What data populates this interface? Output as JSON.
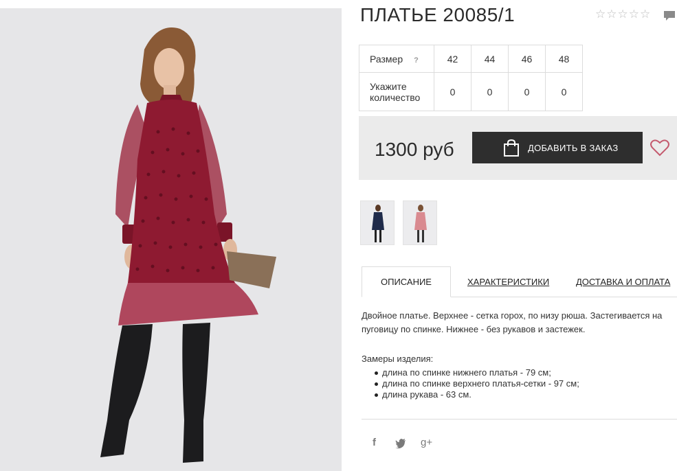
{
  "product": {
    "title": "ПЛАТЬЕ 20085/1",
    "rating_stars": [
      "☆",
      "☆",
      "☆",
      "☆",
      "☆"
    ]
  },
  "sizes": {
    "size_label": "Размер",
    "help_mark": "?",
    "quantity_label": "Укажите количество",
    "items": [
      {
        "size": "42",
        "qty": "0"
      },
      {
        "size": "44",
        "qty": "0"
      },
      {
        "size": "46",
        "qty": "0"
      },
      {
        "size": "48",
        "qty": "0"
      }
    ]
  },
  "purchase": {
    "price": "1300 руб",
    "order_button": "ДОБАВИТЬ В ЗАКАЗ"
  },
  "tabs": {
    "description": "ОПИСАНИЕ",
    "characteristics": "ХАРАКТЕРИСТИКИ",
    "delivery": "ДОСТАВКА И ОПЛАТА"
  },
  "description": {
    "text": "Двойное платье. Верхнее - сетка горох, по низу рюша. Застегивается на пуговицу по спинке. Нижнее - без рукавов и застежек.",
    "measurements_heading": "Замеры изделия:",
    "measurements": [
      "длина по спинке нижнего платья - 79 см;",
      "длина по спинке верхнего платья-сетки - 97 см;",
      "длина рукава - 63 см."
    ]
  },
  "social": {
    "facebook": "f",
    "twitter": "t",
    "google_plus": "g+"
  },
  "colors": {
    "dress": "#8e1a31",
    "button_bg": "#2e2e2e",
    "price_bar_bg": "#ebebeb",
    "heart": "#c45a6e"
  },
  "icons": {
    "comment": "comment-icon",
    "bag": "shopping-bag-icon",
    "heart": "heart-icon",
    "facebook": "facebook-icon",
    "twitter": "twitter-icon",
    "google_plus": "google-plus-icon"
  }
}
